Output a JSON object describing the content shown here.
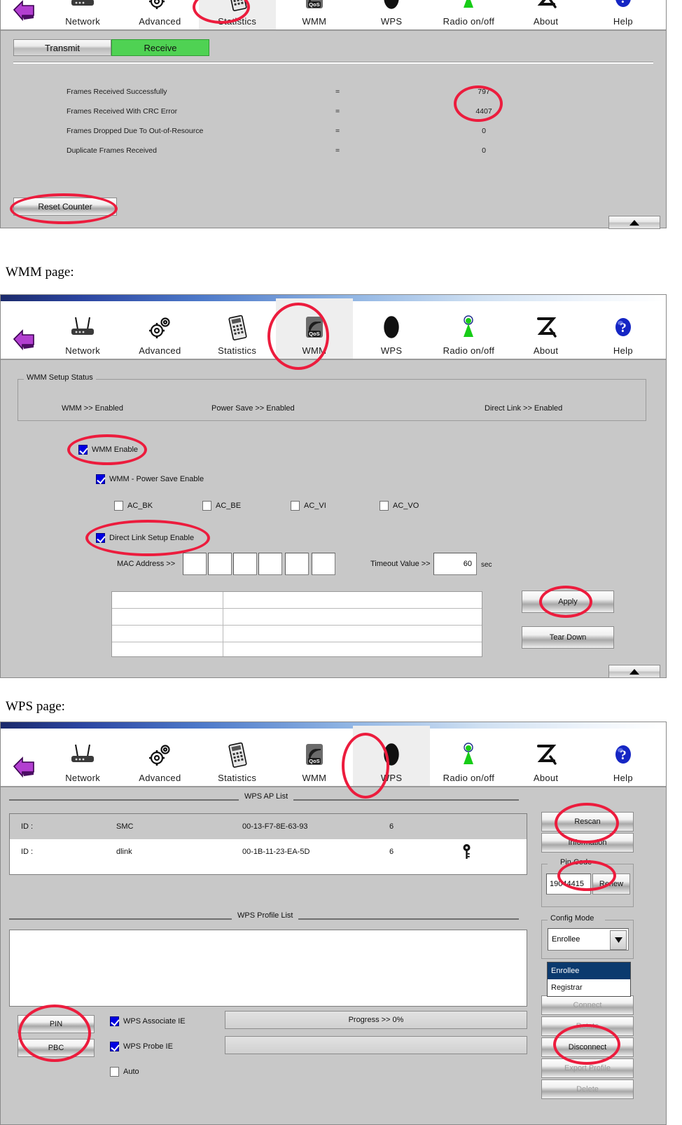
{
  "toolbar": {
    "items": [
      {
        "label": "Network",
        "icon": "router-icon"
      },
      {
        "label": "Advanced",
        "icon": "gears-icon"
      },
      {
        "label": "Statistics",
        "icon": "calculator-icon"
      },
      {
        "label": "WMM",
        "icon": "qos-icon"
      },
      {
        "label": "WPS",
        "icon": "wps-icon"
      },
      {
        "label": "Radio on/off",
        "icon": "antenna-icon"
      },
      {
        "label": "About",
        "icon": "about-icon"
      },
      {
        "label": "Help",
        "icon": "help-icon"
      }
    ],
    "home_icon": "home-arrow-icon"
  },
  "statistics": {
    "tabs": [
      {
        "label": "Transmit",
        "active": false
      },
      {
        "label": "Receive",
        "active": true
      }
    ],
    "rows": [
      {
        "name": "Frames Received Successfully",
        "eq": "=",
        "value": "797"
      },
      {
        "name": "Frames Received With CRC Error",
        "eq": "=",
        "value": "4407"
      },
      {
        "name": "Frames Dropped Due To Out-of-Resource",
        "eq": "=",
        "value": "0"
      },
      {
        "name": "Duplicate Frames Received",
        "eq": "=",
        "value": "0"
      }
    ],
    "reset_button": "Reset Counter"
  },
  "captions": {
    "wmm": "WMM page:",
    "wps": "WPS page:"
  },
  "wmm": {
    "status_group_label": "WMM Setup Status",
    "status": [
      {
        "text": "WMM >>  Enabled"
      },
      {
        "text": "Power Save >>  Enabled"
      },
      {
        "text": "Direct Link >>  Enabled"
      }
    ],
    "checkboxes": [
      {
        "label": "WMM Enable",
        "checked": true
      },
      {
        "label": "WMM - Power Save Enable",
        "checked": true
      },
      {
        "label": "Direct Link Setup Enable",
        "checked": true
      }
    ],
    "ac_checkboxes": [
      {
        "label": "AC_BK",
        "checked": false
      },
      {
        "label": "AC_BE",
        "checked": false
      },
      {
        "label": "AC_VI",
        "checked": false
      },
      {
        "label": "AC_VO",
        "checked": false
      }
    ],
    "mac_label": "MAC Address >>",
    "mac_octets": [
      "",
      "",
      "",
      "",
      "",
      ""
    ],
    "timeout_label": "Timeout Value >>",
    "timeout_value": "60",
    "timeout_unit": "sec",
    "apply_button": "Apply",
    "teardown_button": "Tear Down"
  },
  "wps": {
    "ap_list_label": "WPS AP List",
    "ap_rows": [
      {
        "id": "ID :",
        "ssid": "SMC",
        "mac": "00-13-F7-8E-63-93",
        "channel": "6",
        "lock": false
      },
      {
        "id": "ID :",
        "ssid": "dlink",
        "mac": "00-1B-11-23-EA-5D",
        "channel": "6",
        "lock": true
      }
    ],
    "profile_list_label": "WPS Profile List",
    "left_buttons": [
      {
        "label": "PIN"
      },
      {
        "label": "PBC"
      }
    ],
    "ie_checkboxes": [
      {
        "label": "WPS Associate IE",
        "checked": true
      },
      {
        "label": "WPS Probe IE",
        "checked": true
      },
      {
        "label": "Auto",
        "checked": false
      }
    ],
    "progress_text": "Progress >> 0%",
    "right_buttons": [
      {
        "label": "Rescan",
        "dim": false
      },
      {
        "label": "Information",
        "dim": false
      }
    ],
    "pin_group_label": "Pin Code",
    "pin_value": "19044415",
    "renew_button": "Renew",
    "config_group_label": "Config Mode",
    "config_selected": "Enrollee",
    "config_options": [
      {
        "label": "Enrollee",
        "selected": true
      },
      {
        "label": "Registrar",
        "selected": false
      }
    ],
    "lower_buttons": [
      {
        "label": "Connect",
        "dim": true
      },
      {
        "label": "Rotate",
        "dim": true
      },
      {
        "label": "Disconnect",
        "dim": false
      },
      {
        "label": "Export Profile",
        "dim": true
      },
      {
        "label": "Delete",
        "dim": true
      }
    ]
  },
  "colors": {
    "accent_red": "#ec1c3d",
    "tab_active_green": "#4fd253",
    "checkbox_blue": "#0000e2",
    "dropdown_highlight": "#0b3a6e"
  }
}
